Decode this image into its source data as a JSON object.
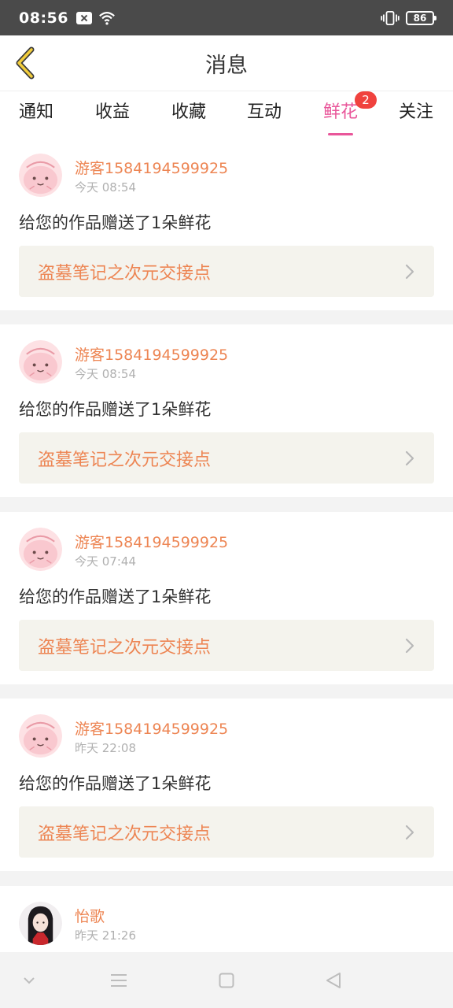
{
  "status_bar": {
    "time": "08:56",
    "battery": "86"
  },
  "header": {
    "title": "消息"
  },
  "tabs": [
    {
      "label": "通知"
    },
    {
      "label": "收益"
    },
    {
      "label": "收藏"
    },
    {
      "label": "互动"
    },
    {
      "label": "鲜花",
      "badge": "2",
      "active": true
    },
    {
      "label": "关注"
    }
  ],
  "messages": [
    {
      "user": "游客1584194599925",
      "time": "今天 08:54",
      "text": "给您的作品赠送了1朵鲜花",
      "work": "盗墓笔记之次元交接点"
    },
    {
      "user": "游客1584194599925",
      "time": "今天 08:54",
      "text": "给您的作品赠送了1朵鲜花",
      "work": "盗墓笔记之次元交接点"
    },
    {
      "user": "游客1584194599925",
      "time": "今天 07:44",
      "text": "给您的作品赠送了1朵鲜花",
      "work": "盗墓笔记之次元交接点"
    },
    {
      "user": "游客1584194599925",
      "time": "昨天 22:08",
      "text": "给您的作品赠送了1朵鲜花",
      "work": "盗墓笔记之次元交接点"
    },
    {
      "user": "怡歌",
      "time": "昨天 21:26"
    }
  ],
  "colors": {
    "accent": "#e9569a",
    "username": "#ed8553",
    "badge": "#f0423e"
  }
}
